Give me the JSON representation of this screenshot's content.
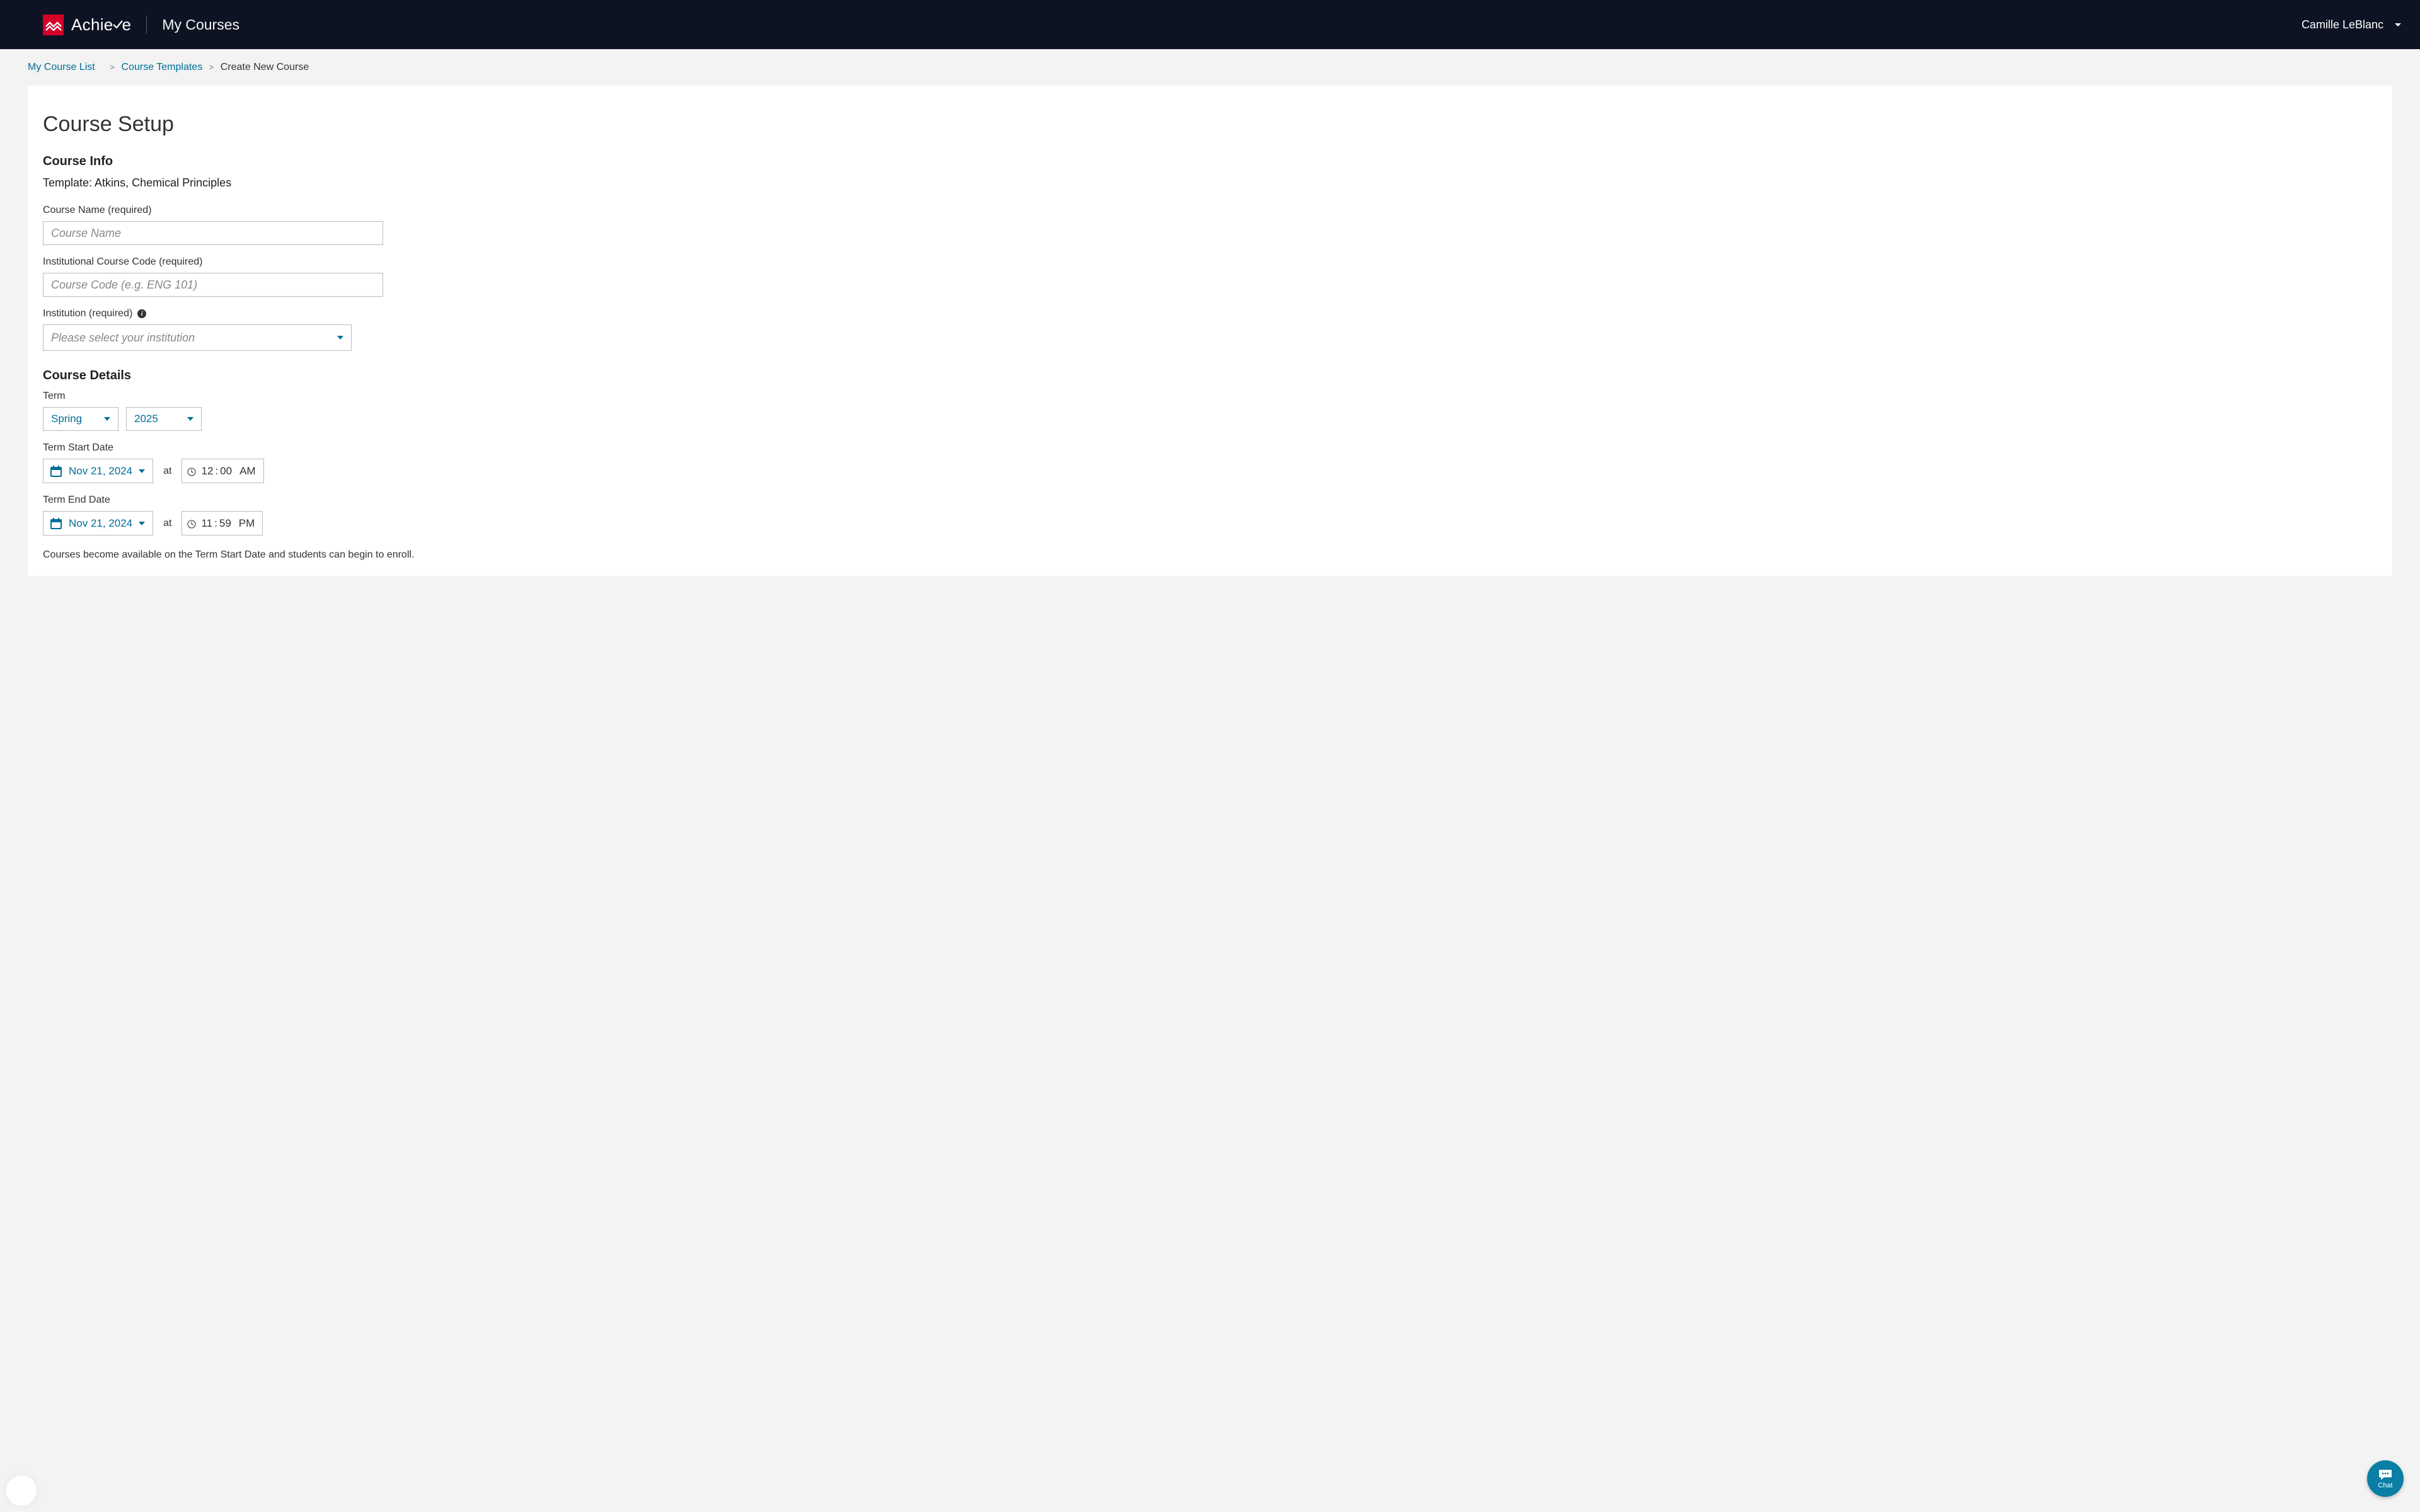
{
  "header": {
    "brand": "Achieve",
    "page": "My Courses",
    "user_name": "Camille LeBlanc"
  },
  "breadcrumb": {
    "items": [
      {
        "label": "My Course List",
        "link": true
      },
      {
        "label": "Course Templates",
        "link": true
      },
      {
        "label": "Create New Course",
        "link": false
      }
    ]
  },
  "page_title": "Course Setup",
  "course_info": {
    "heading": "Course Info",
    "template_line": "Template: Atkins, Chemical Principles",
    "course_name": {
      "label": "Course Name (required)",
      "placeholder": "Course Name",
      "value": ""
    },
    "course_code": {
      "label": "Institutional Course Code (required)",
      "placeholder": "Course Code (e.g. ENG 101)",
      "value": ""
    },
    "institution": {
      "label": "Institution (required)",
      "placeholder": "Please select your institution",
      "value": ""
    }
  },
  "course_details": {
    "heading": "Course Details",
    "term": {
      "label": "Term",
      "season": "Spring",
      "year": "2025"
    },
    "term_start": {
      "label": "Term Start Date",
      "date": "Nov 21, 2024",
      "at": "at",
      "hour": "12",
      "minute": "00",
      "ampm": "AM"
    },
    "term_end": {
      "label": "Term End Date",
      "date": "Nov 21, 2024",
      "at": "at",
      "hour": "11",
      "minute": "59",
      "ampm": "PM"
    },
    "note": "Courses become available on the Term Start Date and students can begin to enroll."
  },
  "chat": {
    "label": "Chat"
  }
}
